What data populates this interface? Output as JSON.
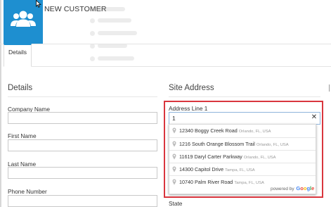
{
  "header": {
    "title": "NEW CUSTOMER",
    "avatar_icon": "users-group-icon",
    "accent_color": "#1e8fd0"
  },
  "tabs": [
    {
      "label": "Details",
      "active": true
    }
  ],
  "details_section": {
    "title": "Details",
    "fields": [
      {
        "label": "Company Name",
        "value": ""
      },
      {
        "label": "First Name",
        "value": ""
      },
      {
        "label": "Last Name",
        "value": ""
      },
      {
        "label": "Phone Number",
        "value": ""
      }
    ]
  },
  "site_address_section": {
    "title": "Site Address",
    "address_line_1": {
      "label": "Address Line 1",
      "value": "1",
      "clear_glyph": "✕"
    },
    "suggestions": [
      {
        "main": "12340 Boggy Creek Road",
        "secondary": "Orlando, FL, USA"
      },
      {
        "main": "1216 South Orange Blossom Trail",
        "secondary": "Orlando, FL, USA"
      },
      {
        "main": "11619 Daryl Carter Parkway",
        "secondary": "Orlando, FL, USA"
      },
      {
        "main": "14300 Capitol Drive",
        "secondary": "Tampa, FL, USA"
      },
      {
        "main": "10740 Palm River Road",
        "secondary": "Tampa, FL, USA"
      }
    ],
    "powered_by": "powered by",
    "powered_brand": "Google",
    "state_label": "State",
    "highlight_color": "#d9363e"
  }
}
